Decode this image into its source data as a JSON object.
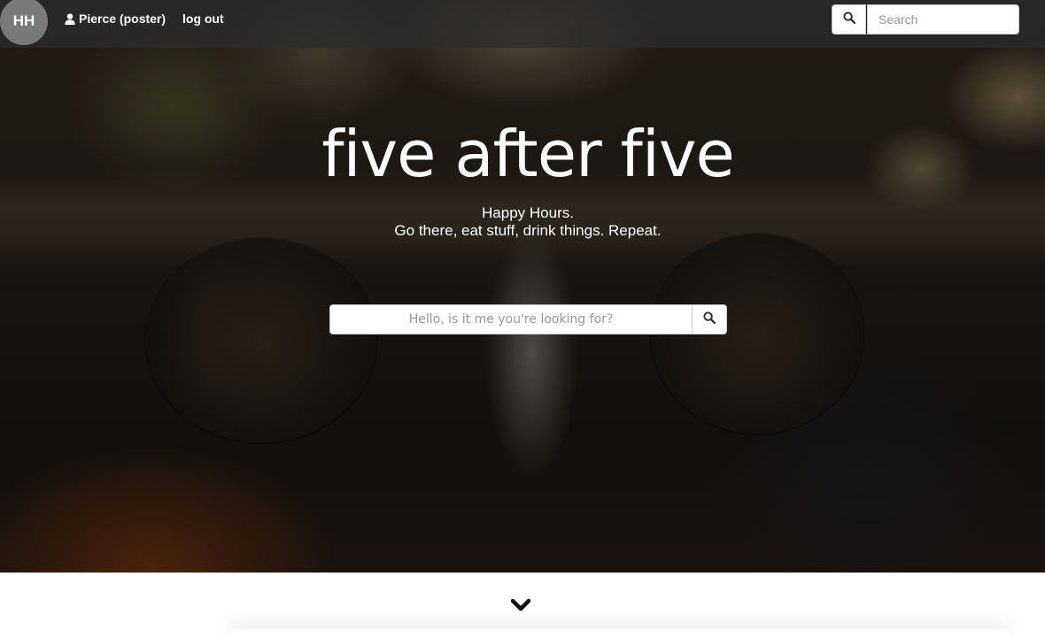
{
  "navbar": {
    "logo_text": "HH",
    "user_icon": "user-icon",
    "user_label": "Pierce (poster)",
    "logout_label": "log out",
    "search_icon": "search-icon",
    "search_placeholder": "Search"
  },
  "hero": {
    "title": "five after five",
    "tagline_line1": "Happy Hours.",
    "tagline_line2": "Go there, eat stuff, drink things. Repeat.",
    "search_placeholder": "Hello, is it me you're looking for?",
    "search_icon": "search-icon"
  },
  "footer": {
    "scroll_icon": "chevron-down-icon"
  }
}
